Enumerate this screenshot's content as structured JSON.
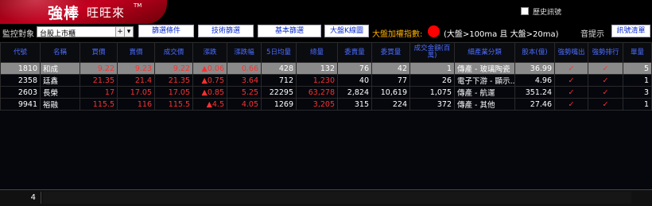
{
  "brand": {
    "title": "強棒",
    "subtitle": "旺旺來",
    "tm": "TM"
  },
  "history": {
    "label": "歷史訊號"
  },
  "toolbar": {
    "monitor_label": "監控對象",
    "market_select": "台股上市櫃",
    "plus": "+",
    "arrow": "▾",
    "btn_filter": "篩選條件",
    "btn_tech": "技術篩選",
    "btn_basic": "基本篩選",
    "btn_kline": "大盤K線圖",
    "index_label": "大盤加權指數:",
    "index_condition": "(大盤>100ma 且 大盤>20ma)",
    "sound_label": "音提示",
    "btn_signals": "訊號清單"
  },
  "colors": {
    "indicator": "#ff0000",
    "header_text": "#4a6cff"
  },
  "table": {
    "headers": [
      "代號",
      "名稱",
      "買價",
      "賣價",
      "成交價",
      "漲跌",
      "漲跌幅",
      "5日均量",
      "總量",
      "委賣量",
      "委買量",
      "成交金額(百萬)",
      "細產業分類",
      "股本(億)",
      "強勢嘴出",
      "強勢排行",
      "單量"
    ],
    "rows": [
      {
        "code": "1810",
        "name": "和成",
        "bid": "9.22",
        "ask": "9.23",
        "price": "9.22",
        "change": "▲0.06",
        "pct": "0.66",
        "avg5": "428",
        "vol": "132",
        "askvol": "76",
        "bidvol": "42",
        "amount": "1",
        "industry": "傳產 - 玻璃陶瓷",
        "capital": "36.99",
        "sig1": "✓",
        "sig2": "✓",
        "unit": "5"
      },
      {
        "code": "2358",
        "name": "廷鑫",
        "bid": "21.35",
        "ask": "21.4",
        "price": "21.35",
        "change": "▲0.75",
        "pct": "3.64",
        "avg5": "712",
        "vol": "1,230",
        "askvol": "40",
        "bidvol": "77",
        "amount": "26",
        "industry": "電子下游 - 顯示...",
        "capital": "4.96",
        "sig1": "✓",
        "sig2": "✓",
        "unit": "1"
      },
      {
        "code": "2603",
        "name": "長榮",
        "bid": "17",
        "ask": "17.05",
        "price": "17.05",
        "change": "▲0.85",
        "pct": "5.25",
        "avg5": "22295",
        "vol": "63,278",
        "askvol": "2,824",
        "bidvol": "10,619",
        "amount": "1,075",
        "industry": "傳產 - 航運",
        "capital": "351.24",
        "sig1": "✓",
        "sig2": "✓",
        "unit": "3"
      },
      {
        "code": "9941",
        "name": "裕融",
        "bid": "115.5",
        "ask": "116",
        "price": "115.5",
        "change": "▲4.5",
        "pct": "4.05",
        "avg5": "1269",
        "vol": "3,205",
        "askvol": "315",
        "bidvol": "224",
        "amount": "372",
        "industry": "傳產 - 其他",
        "capital": "27.46",
        "sig1": "✓",
        "sig2": "✓",
        "unit": "1"
      }
    ]
  },
  "status": {
    "count": "4"
  }
}
